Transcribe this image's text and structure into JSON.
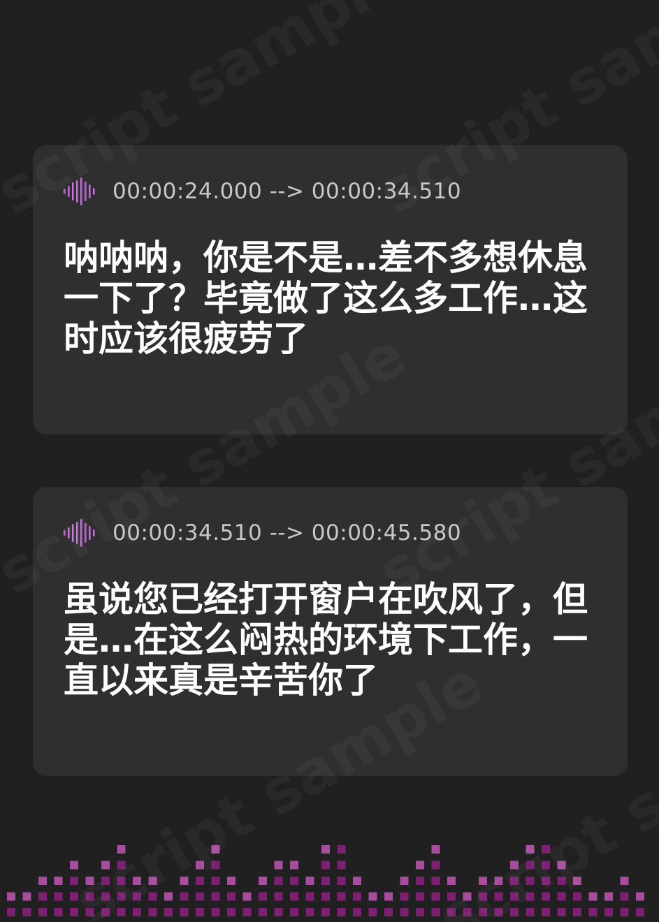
{
  "watermark": {
    "text": "script sample"
  },
  "cues": [
    {
      "timecode": "00:00:24.000 --> 00:00:34.510",
      "text": "呐呐呐，你是不是…差不多想休息一下了？毕竟做了这么多工作…这时应该很疲劳了"
    },
    {
      "timecode": "00:00:34.510 --> 00:00:45.580",
      "text": "虽说您已经打开窗户在吹风了，但是…在这么闷热的环境下工作，一直以来真是辛苦你了"
    }
  ],
  "icons": {
    "cue_icon": "audio-waveform-icon",
    "footer": "equalizer-bars"
  },
  "colors": {
    "background": "#202021",
    "card": "#2f2f30",
    "timecode": "#c8c8c8",
    "text": "#ffffff",
    "accent_pink": "#e05ee8",
    "accent_purple": "#8f2bd8",
    "equalizer": "#7d1f72",
    "equalizer_top": "#a84d9d"
  }
}
